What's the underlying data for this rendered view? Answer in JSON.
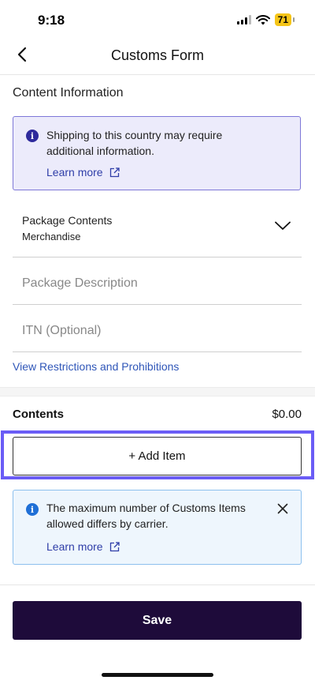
{
  "status_bar": {
    "time": "9:18",
    "battery": "71"
  },
  "header": {
    "title": "Customs Form"
  },
  "content_info": {
    "title": "Content Information",
    "notice": {
      "text": "Shipping to this country may require additional information.",
      "link": "Learn more"
    },
    "package_contents": {
      "label": "Package Contents",
      "value": "Merchandise"
    },
    "package_description": {
      "placeholder": "Package Description"
    },
    "itn": {
      "placeholder": "ITN (Optional)"
    },
    "restrictions_link": "View Restrictions and Prohibitions"
  },
  "contents": {
    "label": "Contents",
    "total": "$0.00",
    "add_item_label": "+ Add Item",
    "notice": {
      "text": "The maximum number of Customs Items allowed differs by carrier.",
      "link": "Learn more"
    }
  },
  "footer": {
    "save_label": "Save"
  },
  "colors": {
    "accent": "#6a5cf6",
    "primary_button": "#1e0b3a",
    "link": "#2f56b8"
  }
}
